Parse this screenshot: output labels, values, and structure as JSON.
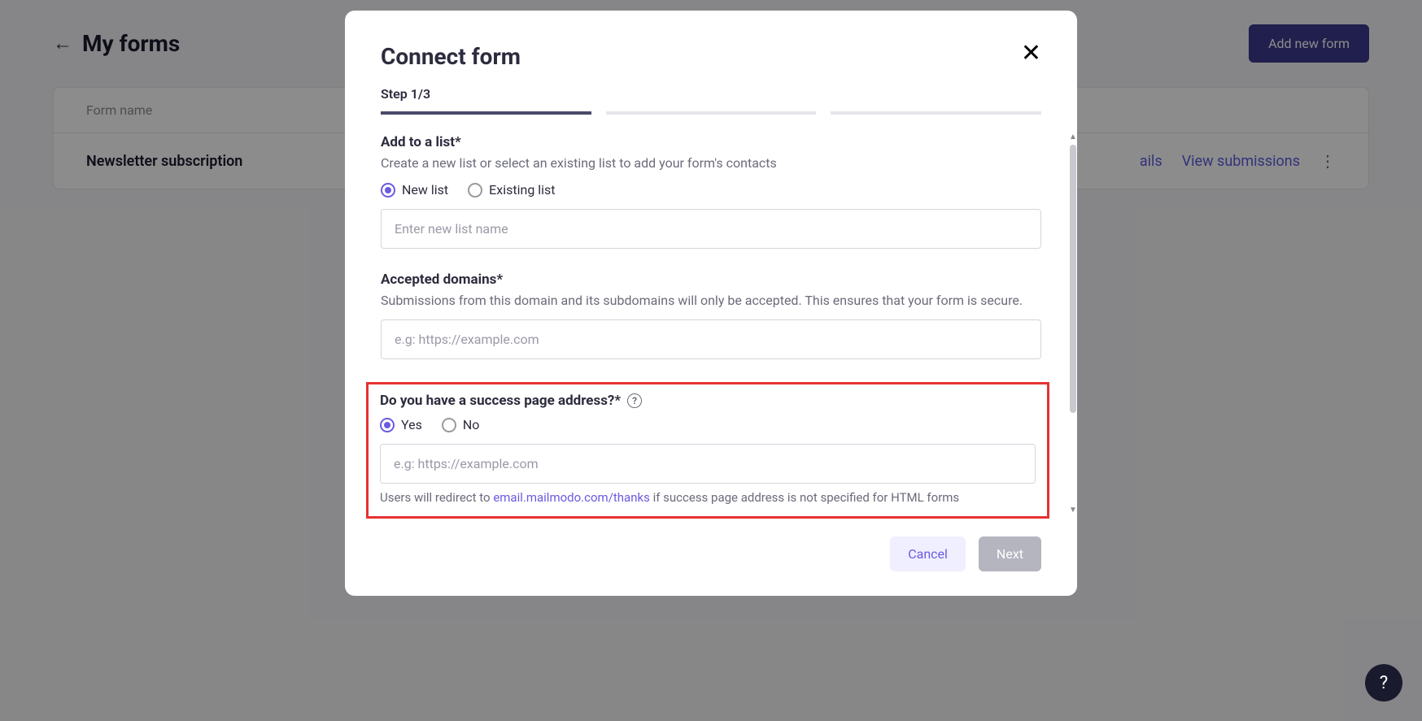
{
  "page": {
    "title": "My forms",
    "addButton": "Add new form",
    "tableHeader": "Form name",
    "rows": [
      {
        "name": "Newsletter subscription",
        "detailsLabel": "ails",
        "viewLabel": "View submissions"
      }
    ]
  },
  "modal": {
    "title": "Connect form",
    "stepLabel": "Step 1/3",
    "addToList": {
      "label": "Add to a list*",
      "desc": "Create a new list or select an existing list to add your form's contacts",
      "newListOption": "New list",
      "existingListOption": "Existing list",
      "inputPlaceholder": "Enter new list name"
    },
    "acceptedDomains": {
      "label": "Accepted domains*",
      "desc": "Submissions from this domain and its subdomains will only be accepted. This ensures that your form is secure.",
      "inputPlaceholder": "e.g: https://example.com"
    },
    "successPage": {
      "label": "Do you have a success page address?*",
      "yesOption": "Yes",
      "noOption": "No",
      "inputPlaceholder": "e.g: https://example.com",
      "hintPrefix": "Users will redirect to ",
      "hintLink": "email.mailmodo.com/thanks",
      "hintSuffix": " if success page address is not specified for HTML forms"
    },
    "cancelLabel": "Cancel",
    "nextLabel": "Next"
  }
}
